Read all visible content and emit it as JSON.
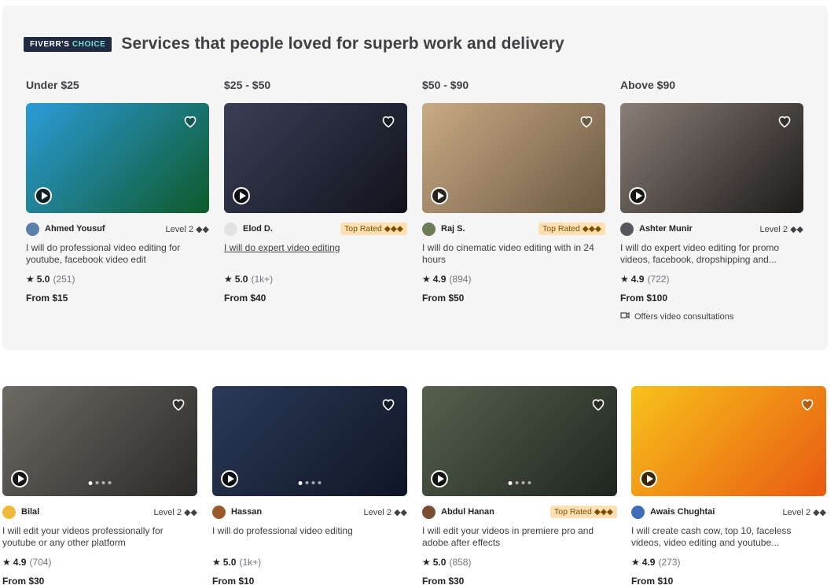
{
  "choice": {
    "badge_pre": "FIVERR'S",
    "badge_post": "CHOICE",
    "title": "Services that people loved for superb work and delivery",
    "price_ranges": [
      "Under $25",
      "$25 - $50",
      "$50 - $90",
      "Above $90"
    ]
  },
  "featured": [
    {
      "seller": "Ahmed Yousuf",
      "badge": "Level 2 ◆◆",
      "badge_type": "level",
      "title": "I will do professional video editing for youtube, facebook video edit",
      "score": "5.0",
      "count": "(251)",
      "price": "From $15",
      "thumb_colors": [
        "#2c9bd9",
        "#0e5a2a"
      ]
    },
    {
      "seller": "Elod D.",
      "badge": "Top Rated ◆◆◆",
      "badge_type": "top",
      "title": "I will do expert video editing",
      "score": "5.0",
      "count": "(1k+)",
      "price": "From $40",
      "thumb_colors": [
        "#3a3f56",
        "#11131c"
      ]
    },
    {
      "seller": "Raj S.",
      "badge": "Top Rated ◆◆◆",
      "badge_type": "top",
      "title": "I will do cinematic video editing with in 24 hours",
      "score": "4.9",
      "count": "(894)",
      "price": "From $50",
      "thumb_colors": [
        "#c9ab86",
        "#6b5840"
      ]
    },
    {
      "seller": "Ashter Munir",
      "badge": "Level 2 ◆◆",
      "badge_type": "level",
      "title": "I will do expert video editing for promo videos, facebook, dropshipping and...",
      "score": "4.9",
      "count": "(722)",
      "price": "From $100",
      "thumb_colors": [
        "#8a7f77",
        "#1d1b1a"
      ],
      "consult": "Offers video consultations"
    }
  ],
  "gigs": [
    {
      "seller": "Bilal",
      "badge": "Level 2 ◆◆",
      "badge_type": "level",
      "title": "I will edit your videos professionally for youtube or any other platform",
      "score": "4.9",
      "count": "(704)",
      "price": "From $30",
      "thumb_colors": [
        "#6e6a64",
        "#2b2a28"
      ]
    },
    {
      "seller": "Hassan",
      "badge": "Level 2 ◆◆",
      "badge_type": "level",
      "title": "I will do professional video editing",
      "score": "5.0",
      "count": "(1k+)",
      "price": "From $10",
      "thumb_colors": [
        "#2c3a58",
        "#0f1525"
      ]
    },
    {
      "seller": "Abdul Hanan",
      "badge": "Top Rated ◆◆◆",
      "badge_type": "top",
      "title": "I will edit your videos in premiere pro and adobe after effects",
      "score": "5.0",
      "count": "(858)",
      "price": "From $30",
      "thumb_colors": [
        "#57604e",
        "#1f261f"
      ]
    },
    {
      "seller": "Awais Chughtai",
      "badge": "Level 2 ◆◆",
      "badge_type": "level",
      "title": "I will create cash cow, top 10, faceless videos, video editing and youtube...",
      "score": "4.9",
      "count": "(273)",
      "price": "From $10",
      "thumb_colors": [
        "#f7c21a",
        "#e85a12"
      ]
    }
  ]
}
